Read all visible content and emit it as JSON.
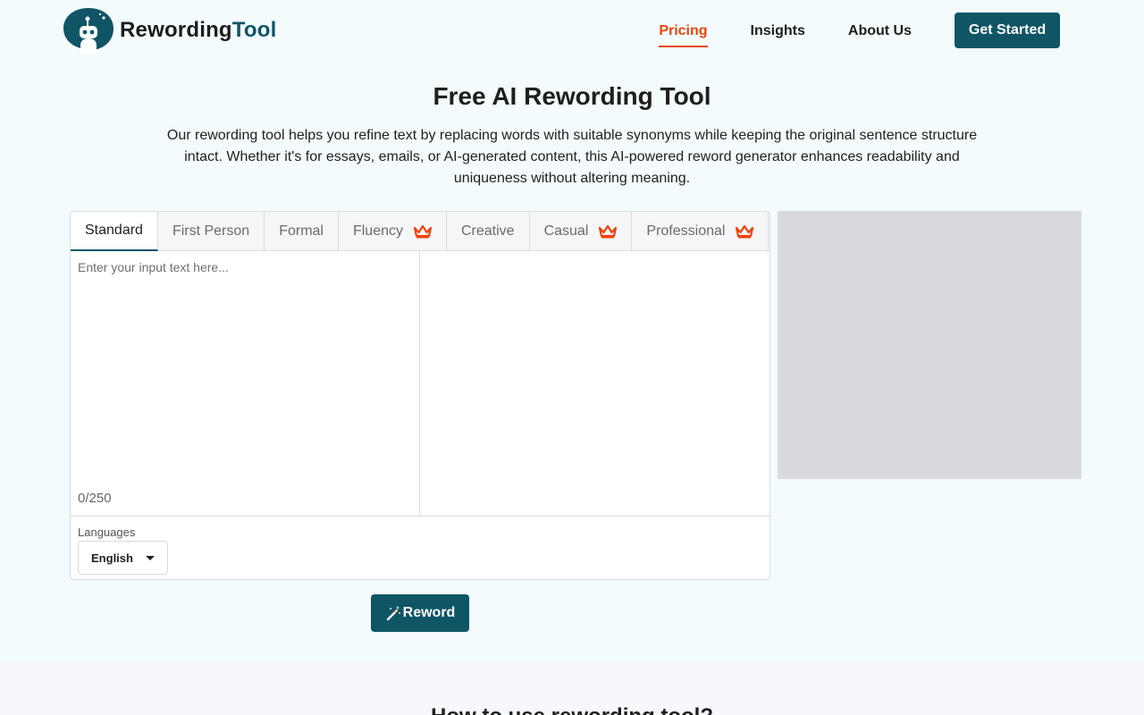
{
  "brand": {
    "name_part1": "Rewording",
    "name_part2": "Tool"
  },
  "nav": {
    "items": [
      {
        "label": "Pricing",
        "active": true
      },
      {
        "label": "Insights"
      },
      {
        "label": "About Us"
      }
    ],
    "cta": "Get Started"
  },
  "hero": {
    "title": "Free AI Rewording Tool",
    "description": "Our rewording tool helps you refine text by replacing words with suitable synonyms while keeping the original sentence structure intact. Whether it's for essays, emails, or AI-generated content, this AI-powered reword generator enhances readability and uniqueness without altering meaning."
  },
  "tool": {
    "tabs": [
      {
        "label": "Standard",
        "active": true,
        "premium": false
      },
      {
        "label": "First Person",
        "premium": false
      },
      {
        "label": "Formal",
        "premium": false
      },
      {
        "label": "Fluency",
        "premium": true
      },
      {
        "label": "Creative",
        "premium": false
      },
      {
        "label": "Casual",
        "premium": true
      },
      {
        "label": "Professional",
        "premium": true
      }
    ],
    "input_placeholder": "Enter your input text here...",
    "input_value": "",
    "counter": "0/250",
    "languages_label": "Languages",
    "language_selected": "English",
    "reword_button": "Reword"
  },
  "section2": {
    "title": "How to use rewording tool?"
  },
  "colors": {
    "brand": "#0f5565",
    "accent": "#e8470d",
    "crown": "#f0410b"
  }
}
